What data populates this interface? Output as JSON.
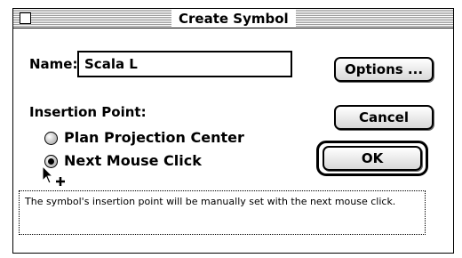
{
  "window": {
    "title": "Create Symbol"
  },
  "name_field": {
    "label": "Name:",
    "value": "Scala L"
  },
  "insertion_point": {
    "heading": "Insertion Point:",
    "options": [
      {
        "label": "Plan Projection Center",
        "selected": false
      },
      {
        "label": "Next Mouse Click",
        "selected": true
      }
    ]
  },
  "buttons": {
    "options": "Options ...",
    "cancel": "Cancel",
    "ok": "OK"
  },
  "info": {
    "text": "The symbol's insertion point will be manually set with the next mouse click."
  },
  "icons": {
    "close": "close-box-icon",
    "cursor": "insertion-cursor-icon"
  },
  "colors": {
    "text": "#000000",
    "background": "#ffffff",
    "titlebar_stripe": "#9a9a9a"
  }
}
